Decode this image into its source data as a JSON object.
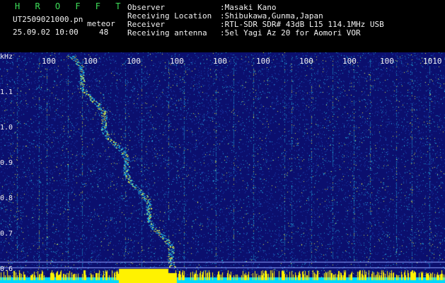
{
  "header": {
    "app_title": "H R O F F T",
    "file_name": "UT2509021000.pn",
    "detection_label": "meteor",
    "timestamp": "25.09.02 10:00",
    "count": "48",
    "info": [
      {
        "label": "Observer",
        "value": ":Masaki Kano"
      },
      {
        "label": "Receiving Location",
        "value": ":Shibukawa,Gunma,Japan"
      },
      {
        "label": "Receiver",
        "value": ":RTL-SDR SDR# 43dB L15 114.1MHz USB"
      },
      {
        "label": "Receiving antenna",
        "value": ":5el Yagi Az 20 for Aomori VOR"
      }
    ]
  },
  "axis": {
    "y_unit": "kHz",
    "y_ticks": [
      "1.1",
      "1.0",
      "0.9",
      "0.8",
      "0.7",
      "0.6"
    ],
    "x_ticks": [
      "100",
      "100",
      "100",
      "100",
      "100",
      "100",
      "100",
      "100",
      "100",
      "1010"
    ]
  },
  "colors": {
    "background": "#0b0f6e",
    "noise_low": "#1a3fb0",
    "noise_mid": "#1fa6d6",
    "noise_high": "#d6e84a",
    "baseline": "#00d8ff",
    "highlight": "#fff200"
  }
}
